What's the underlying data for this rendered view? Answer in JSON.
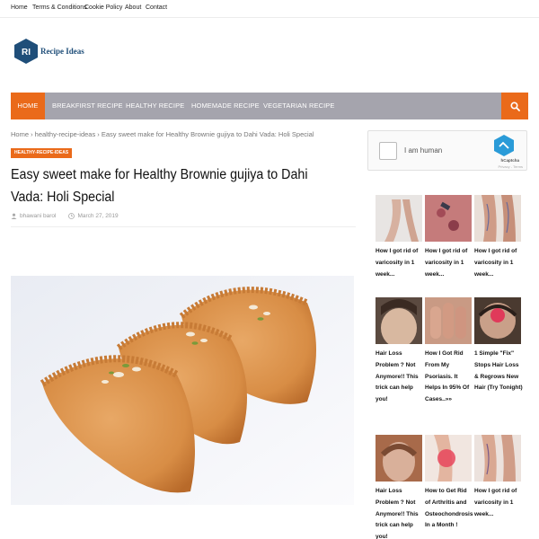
{
  "topbar": {
    "links": [
      "Home",
      "Terms & Conditions",
      "Cookie Policy",
      "About",
      "Contact"
    ]
  },
  "logo": {
    "mark": "RI",
    "text": "Recipe Ideas"
  },
  "nav": {
    "items": [
      "HOME",
      "BREAKFIRST RECIPE",
      "HEALTHY RECIPE",
      "HOMEMADE RECIPE",
      "VEGETARIAN RECIPE"
    ],
    "search_icon": "search-icon",
    "accent": "#ea6a1a",
    "bar_color": "#a5a4ad"
  },
  "breadcrumb": {
    "text": "Home › healthy-recipe-ideas › Easy sweet make for Healthy Brownie gujiya to Dahi Vada: Holi Special"
  },
  "article": {
    "category": "HEALTHY-RECIPE-IDEAS",
    "title": "Easy sweet make for Healthy Brownie gujiya to Dahi Vada: Holi Special",
    "author": "bhawani barol",
    "date": "March 27, 2019"
  },
  "captcha": {
    "label": "I am human",
    "brand": "hCaptcha",
    "links": "Privacy - Terms"
  },
  "sidebar_ads": [
    {
      "text": "How I got rid of varicosity in 1 week..."
    },
    {
      "text": "How I got rid of varicosity in 1 week..."
    },
    {
      "text": "How I got rid of varicosity in 1 week..."
    },
    {
      "text": "Hair Loss Problem ? Not Anymore!! This trick can help you!"
    },
    {
      "text": "How I Got Rid From My Psoriasis. It Helps In 95% Of Cases..»»"
    },
    {
      "text": "1 Simple \"Fix\" Stops Hair Loss & Regrows New Hair (Try Tonight)"
    },
    {
      "text": "Hair Loss Problem ? Not Anymore!! This trick can help you!"
    },
    {
      "text": "How to Get Rid of Arthritis and Osteochondrosis In a Month !"
    },
    {
      "text": "How I got rid of varicosity in 1 week..."
    }
  ]
}
